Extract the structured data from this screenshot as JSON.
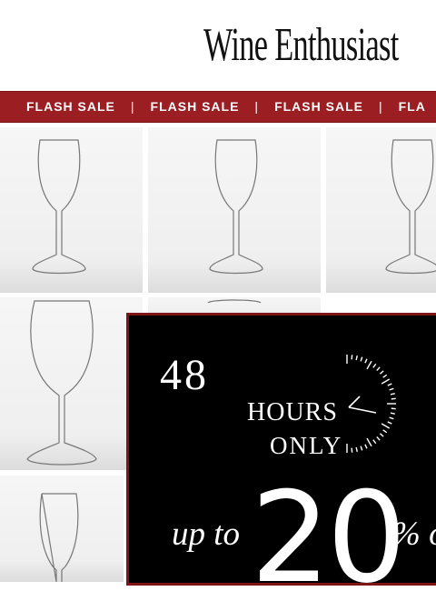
{
  "brand": {
    "logo_text": "Wine Enthusiast"
  },
  "banner": {
    "items": [
      "FLASH SALE",
      "FLASH SALE",
      "FLASH SALE",
      "FLA"
    ],
    "separator": "|"
  },
  "product_grid": {
    "icon": "wine-glass-icon"
  },
  "promo": {
    "hours_number": "48",
    "hours_label": "HOURS",
    "only_label": "ONLY",
    "up_to_label": "up to",
    "discount_value": "20",
    "percent_label": "% o"
  },
  "colors": {
    "banner_red": "#9a1e22",
    "promo_bg": "#000000",
    "promo_border": "#7c1418"
  }
}
